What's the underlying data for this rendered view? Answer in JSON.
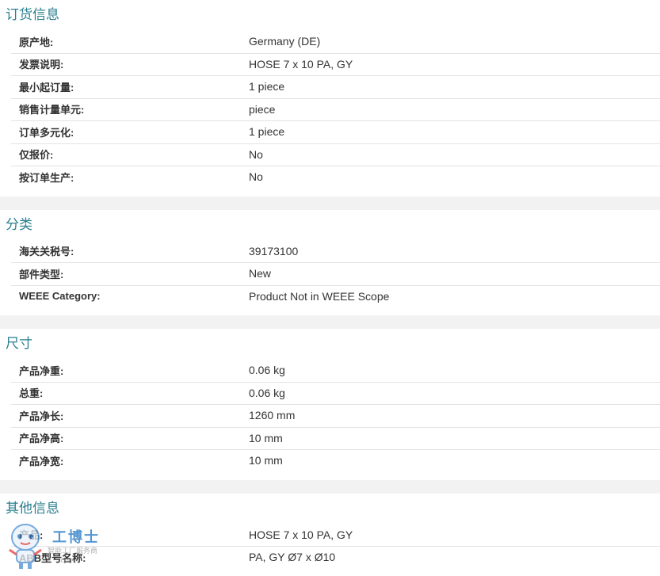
{
  "sections": [
    {
      "title": "订货信息",
      "rows": [
        {
          "label": "原产地:",
          "value": "Germany (DE)"
        },
        {
          "label": "发票说明:",
          "value": "HOSE 7 x 10 PA, GY"
        },
        {
          "label": "最小起订量:",
          "value": "1 piece"
        },
        {
          "label": "销售计量单元:",
          "value": "piece"
        },
        {
          "label": "订单多元化:",
          "value": "1 piece"
        },
        {
          "label": "仅报价:",
          "value": "No"
        },
        {
          "label": "按订单生产:",
          "value": "No"
        }
      ]
    },
    {
      "title": "分类",
      "rows": [
        {
          "label": "海关关税号:",
          "value": "39173100"
        },
        {
          "label": "部件类型:",
          "value": "New"
        },
        {
          "label": "WEEE Category:",
          "value": "Product Not in WEEE Scope"
        }
      ]
    },
    {
      "title": "尺寸",
      "rows": [
        {
          "label": "产品净重:",
          "value": "0.06 kg"
        },
        {
          "label": "总重:",
          "value": "0.06 kg"
        },
        {
          "label": "产品净长:",
          "value": "1260 mm"
        },
        {
          "label": "产品净高:",
          "value": "10 mm"
        },
        {
          "label": "产品净宽:",
          "value": "10 mm"
        }
      ]
    },
    {
      "title": "其他信息",
      "rows": [
        {
          "label": "产品:",
          "value": "HOSE 7 x 10 PA, GY"
        },
        {
          "label": "ABB型号名称:",
          "value": "PA, GY Ø7 x Ø10"
        }
      ]
    }
  ],
  "watermark": {
    "name": "工博士",
    "tagline": "智能工厂服务商",
    "url": ".com"
  },
  "colors": {
    "section_title": "#2a7f8f",
    "divider": "#e3e3e3",
    "gap": "#f2f2f2"
  }
}
